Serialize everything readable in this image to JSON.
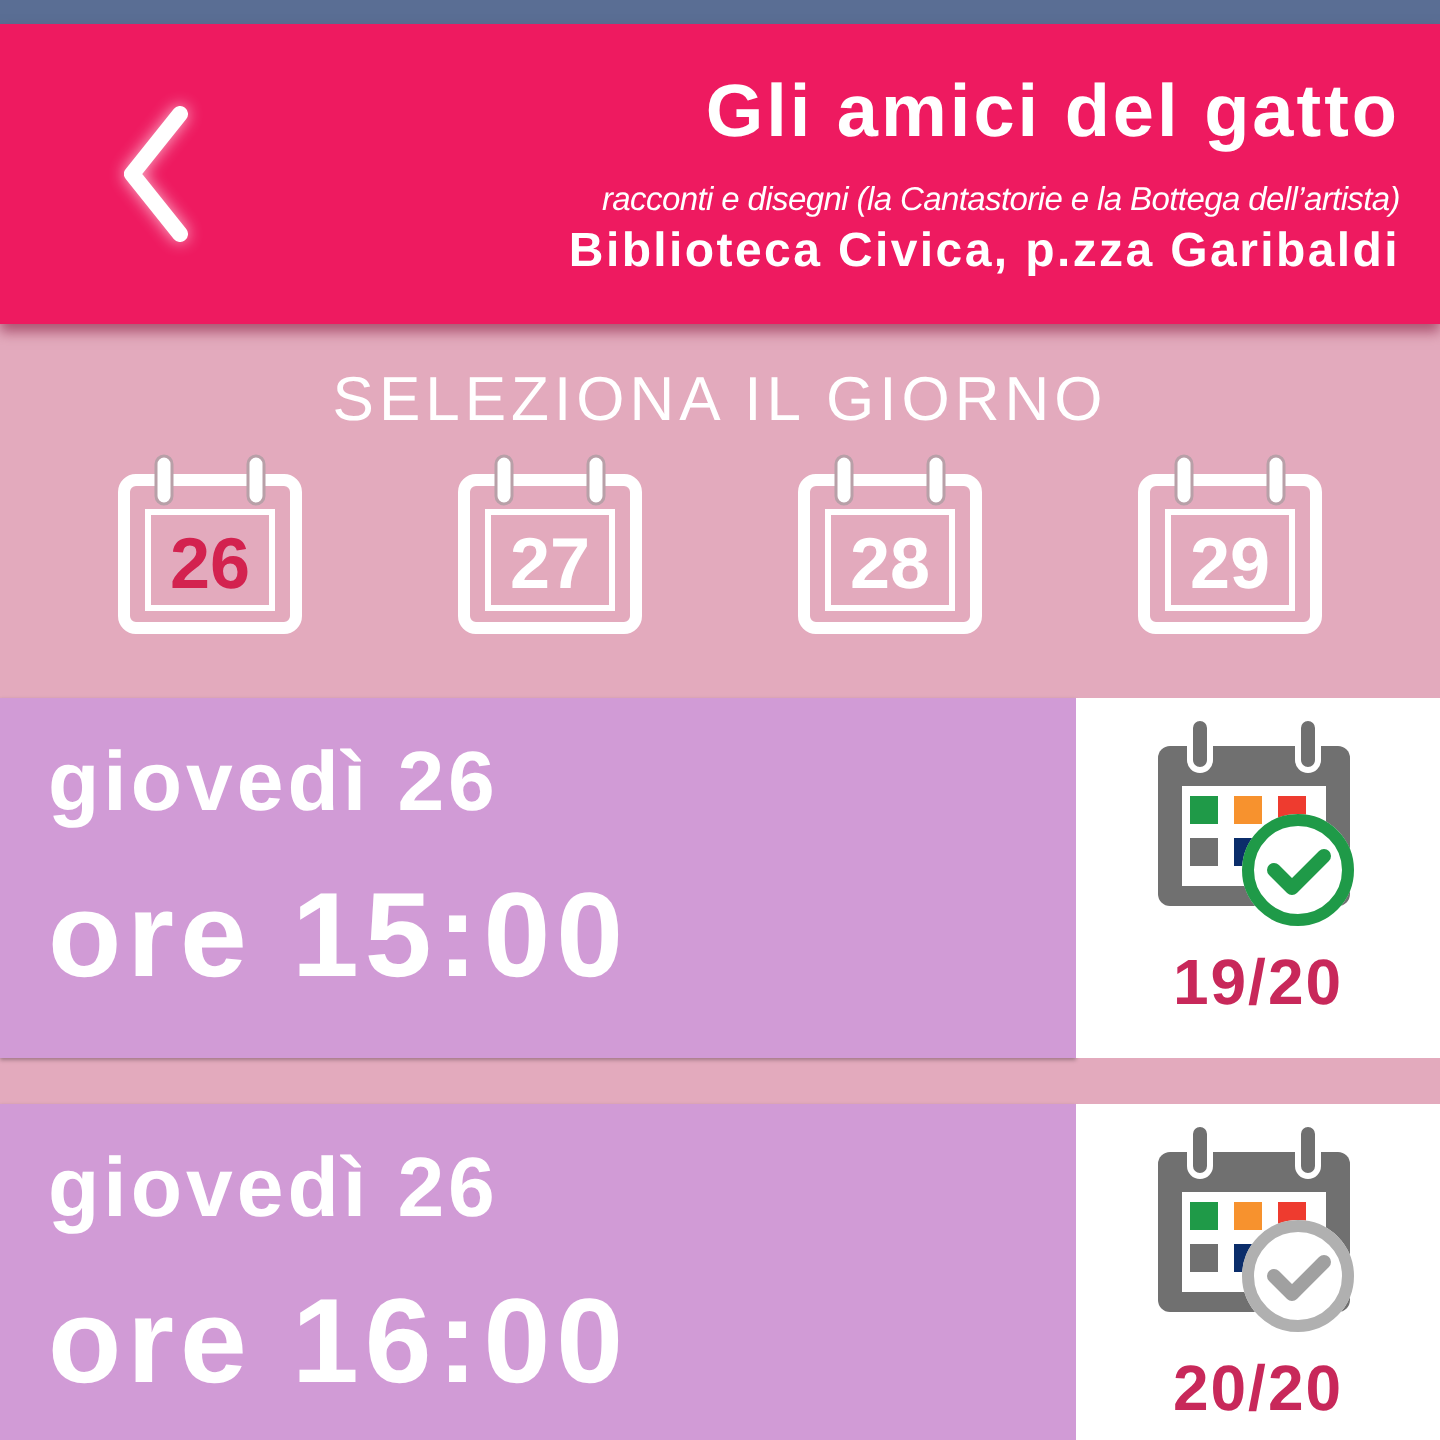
{
  "header": {
    "title": "Gli amici del gatto",
    "subtitle": "racconti e disegni (la Cantastorie e la Bottega dell’artista)",
    "location": "Biblioteca Civica, p.zza Garibaldi"
  },
  "day_picker": {
    "title": "SELEZIONA IL GIORNO",
    "days": [
      {
        "label": "26",
        "selected": true
      },
      {
        "label": "27",
        "selected": false
      },
      {
        "label": "28",
        "selected": false
      },
      {
        "label": "29",
        "selected": false
      }
    ]
  },
  "slots": [
    {
      "day": "giovedì 26",
      "time": "ore 15:00",
      "count": "19/20",
      "available": true
    },
    {
      "day": "giovedì 26",
      "time": "ore 16:00",
      "count": "20/20",
      "available": false
    }
  ]
}
